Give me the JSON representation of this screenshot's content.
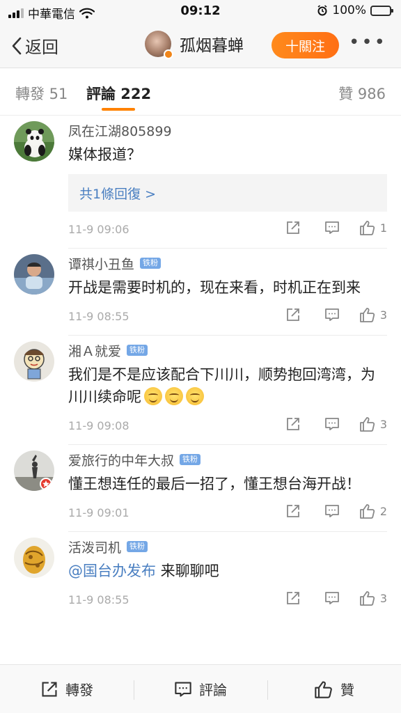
{
  "status_bar": {
    "carrier": "中華電信",
    "time": "09:12",
    "battery": "100%"
  },
  "nav": {
    "back_label": "返回",
    "username": "孤烟暮蝉",
    "follow_label": "十關注",
    "more_label": "•••"
  },
  "tabs": {
    "repost_label": "轉發 51",
    "comments_label": "評論 222",
    "likes_label": "贊 986"
  },
  "comments": [
    {
      "name": "凤在江湖805899",
      "text": "媒体报道？",
      "reply_label": "共1條回復 >",
      "time": "11-9 09:06",
      "likes": "1"
    },
    {
      "name": "谭祺小丑鱼",
      "badge": "铁粉",
      "text": "开战是需要时机的，现在来看，时机正在到来",
      "time": "11-9 08:55",
      "likes": "3"
    },
    {
      "name": "湘Ａ就爱",
      "badge": "铁粉",
      "text": "我们是不是应该配合下川川，顺势抱回湾湾，为川川续命呢",
      "time": "11-9 09:08",
      "likes": "3"
    },
    {
      "name": "爱旅行的中年大叔",
      "badge": "铁粉",
      "text": "懂王想连任的最后一招了，懂王想台海开战！",
      "time": "11-9 09:01",
      "likes": "2"
    },
    {
      "name": "活泼司机",
      "badge": "铁粉",
      "mention": "@国台办发布",
      "text": " 来聊聊吧",
      "time": "11-9 08:55",
      "likes": "3"
    }
  ],
  "bottom_bar": {
    "repost_label": "轉發",
    "comment_label": "評論",
    "like_label": "贊"
  }
}
